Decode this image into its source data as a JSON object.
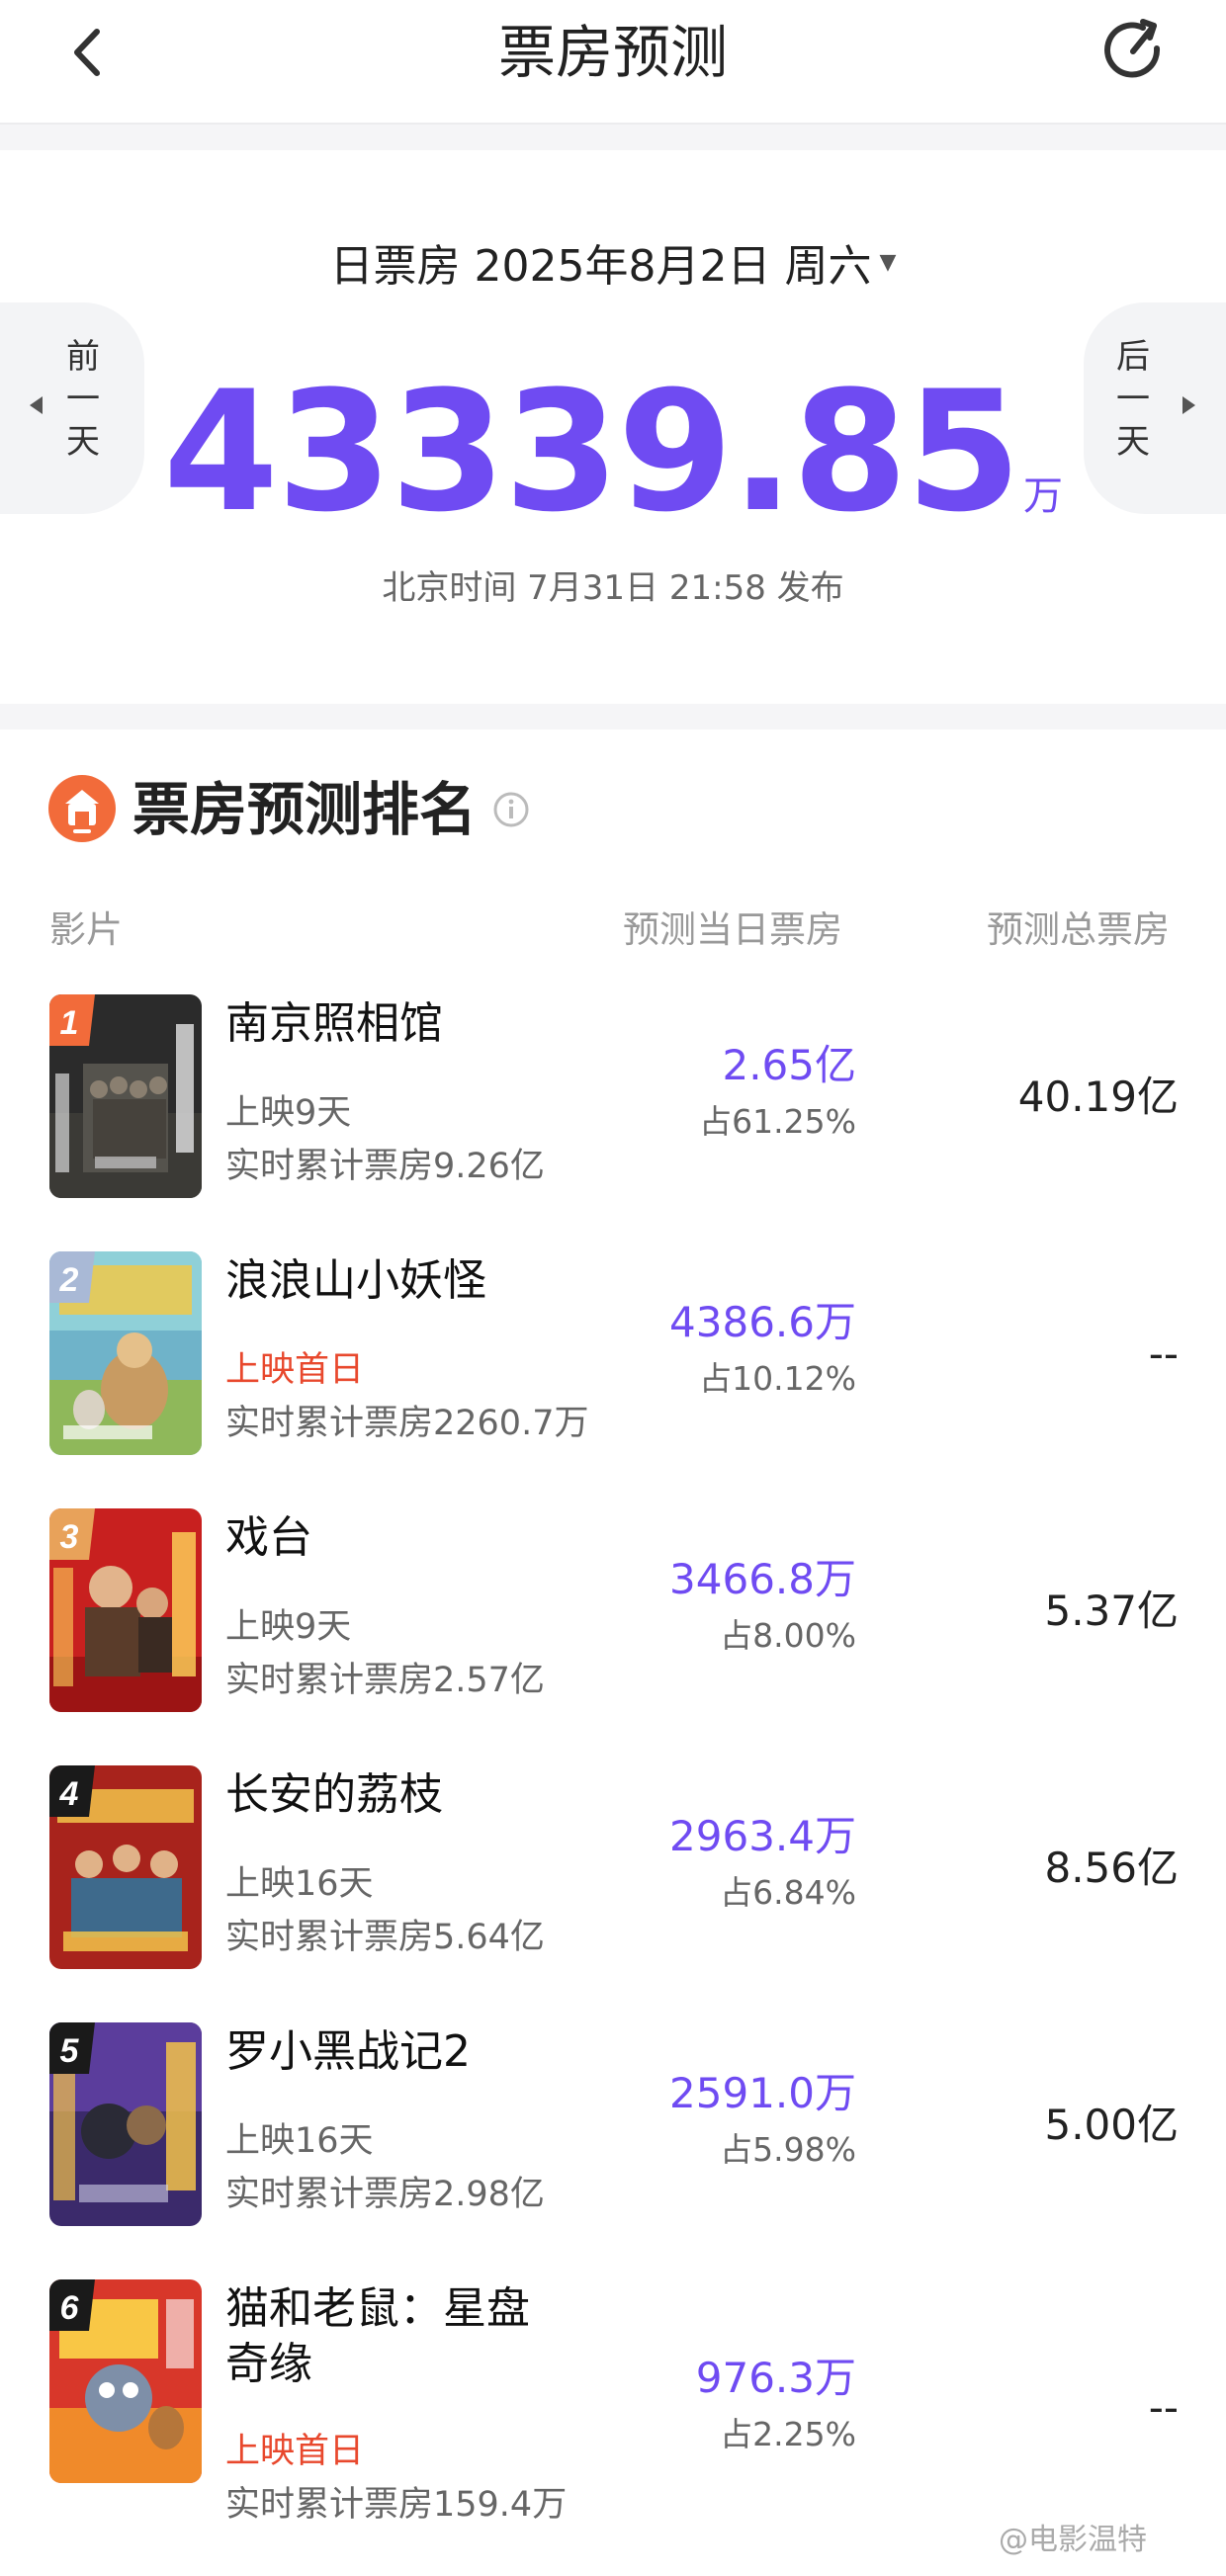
{
  "header": {
    "title": "票房预测",
    "back_icon": "chevron-left-icon",
    "refresh_icon": "refresh-icon"
  },
  "summary": {
    "date_label": "日票房 2025年8月2日 周六",
    "prev_label": "前一天",
    "next_label": "后一天",
    "total_value": "43339.85",
    "total_unit": "万",
    "publish_text": "北京时间 7月31日 21:58 发布"
  },
  "ranking": {
    "title": "票房预测排名",
    "columns": {
      "film": "影片",
      "day_forecast": "预测当日票房",
      "total_forecast": "预测总票房"
    },
    "films": [
      {
        "rank": "1",
        "name": "南京照相馆",
        "status": "上映9天",
        "cumulative": "实时累计票房9.26亿",
        "day_value": "2.65亿",
        "share": "占61.25%",
        "total": "40.19亿"
      },
      {
        "rank": "2",
        "name": "浪浪山小妖怪",
        "status": "上映首日",
        "cumulative": "实时累计票房2260.7万",
        "day_value": "4386.6万",
        "share": "占10.12%",
        "total": "--"
      },
      {
        "rank": "3",
        "name": "戏台",
        "status": "上映9天",
        "cumulative": "实时累计票房2.57亿",
        "day_value": "3466.8万",
        "share": "占8.00%",
        "total": "5.37亿"
      },
      {
        "rank": "4",
        "name": "长安的荔枝",
        "status": "上映16天",
        "cumulative": "实时累计票房5.64亿",
        "day_value": "2963.4万",
        "share": "占6.84%",
        "total": "8.56亿"
      },
      {
        "rank": "5",
        "name": "罗小黑战记2",
        "status": "上映16天",
        "cumulative": "实时累计票房2.98亿",
        "day_value": "2591.0万",
        "share": "占5.98%",
        "total": "5.00亿"
      },
      {
        "rank": "6",
        "name": "猫和老鼠：星盘奇缘",
        "status": "上映首日",
        "cumulative": "实时累计票房159.4万",
        "day_value": "976.3万",
        "share": "占2.25%",
        "total": "--"
      }
    ]
  },
  "watermark": "@电影温特",
  "colors": {
    "accent": "#6f4bf2",
    "first_day": "#e8482d",
    "rank_icon": "#f26b3a",
    "muted": "#999999"
  }
}
